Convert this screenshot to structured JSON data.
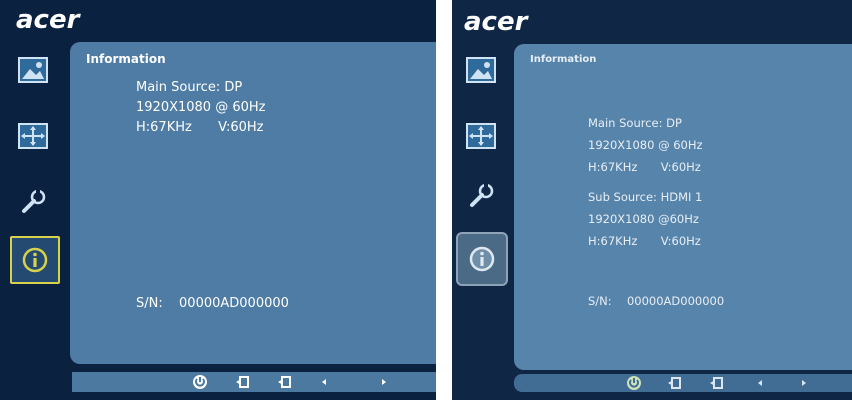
{
  "left_osd": {
    "brand": "acer",
    "title": "Information",
    "main_source": "Main Source: DP",
    "resolution": "1920X1080 @ 60Hz",
    "h_freq": "H:67KHz",
    "v_freq": "V:60Hz",
    "sn_label": "S/N:",
    "sn_value": "00000AD000000",
    "sidebar_icons": [
      "picture-icon",
      "osd-position-icon",
      "settings-wrench-icon",
      "information-icon"
    ],
    "bottom_icons": [
      "power-icon",
      "input-icon",
      "input-icon-2",
      "arrow-left-icon",
      "arrow-right-icon"
    ],
    "selected_color": "#d8d24a"
  },
  "right_osd": {
    "brand": "acer",
    "title": "Information",
    "main_source": "Main Source: DP",
    "main_resolution": "1920X1080 @ 60Hz",
    "main_h_freq": "H:67KHz",
    "main_v_freq": "V:60Hz",
    "sub_source": "Sub Source: HDMI 1",
    "sub_resolution": "1920X1080 @60Hz",
    "sub_h_freq": "H:67KHz",
    "sub_v_freq": "V:60Hz",
    "sn_label": "S/N:",
    "sn_value": "00000AD000000",
    "sidebar_icons": [
      "picture-icon",
      "osd-position-icon",
      "settings-wrench-icon",
      "information-icon"
    ],
    "bottom_icons": [
      "power-icon",
      "input-icon",
      "input-icon-2",
      "arrow-left-icon",
      "arrow-right-icon"
    ],
    "selected_color": "#8ea3b8"
  }
}
